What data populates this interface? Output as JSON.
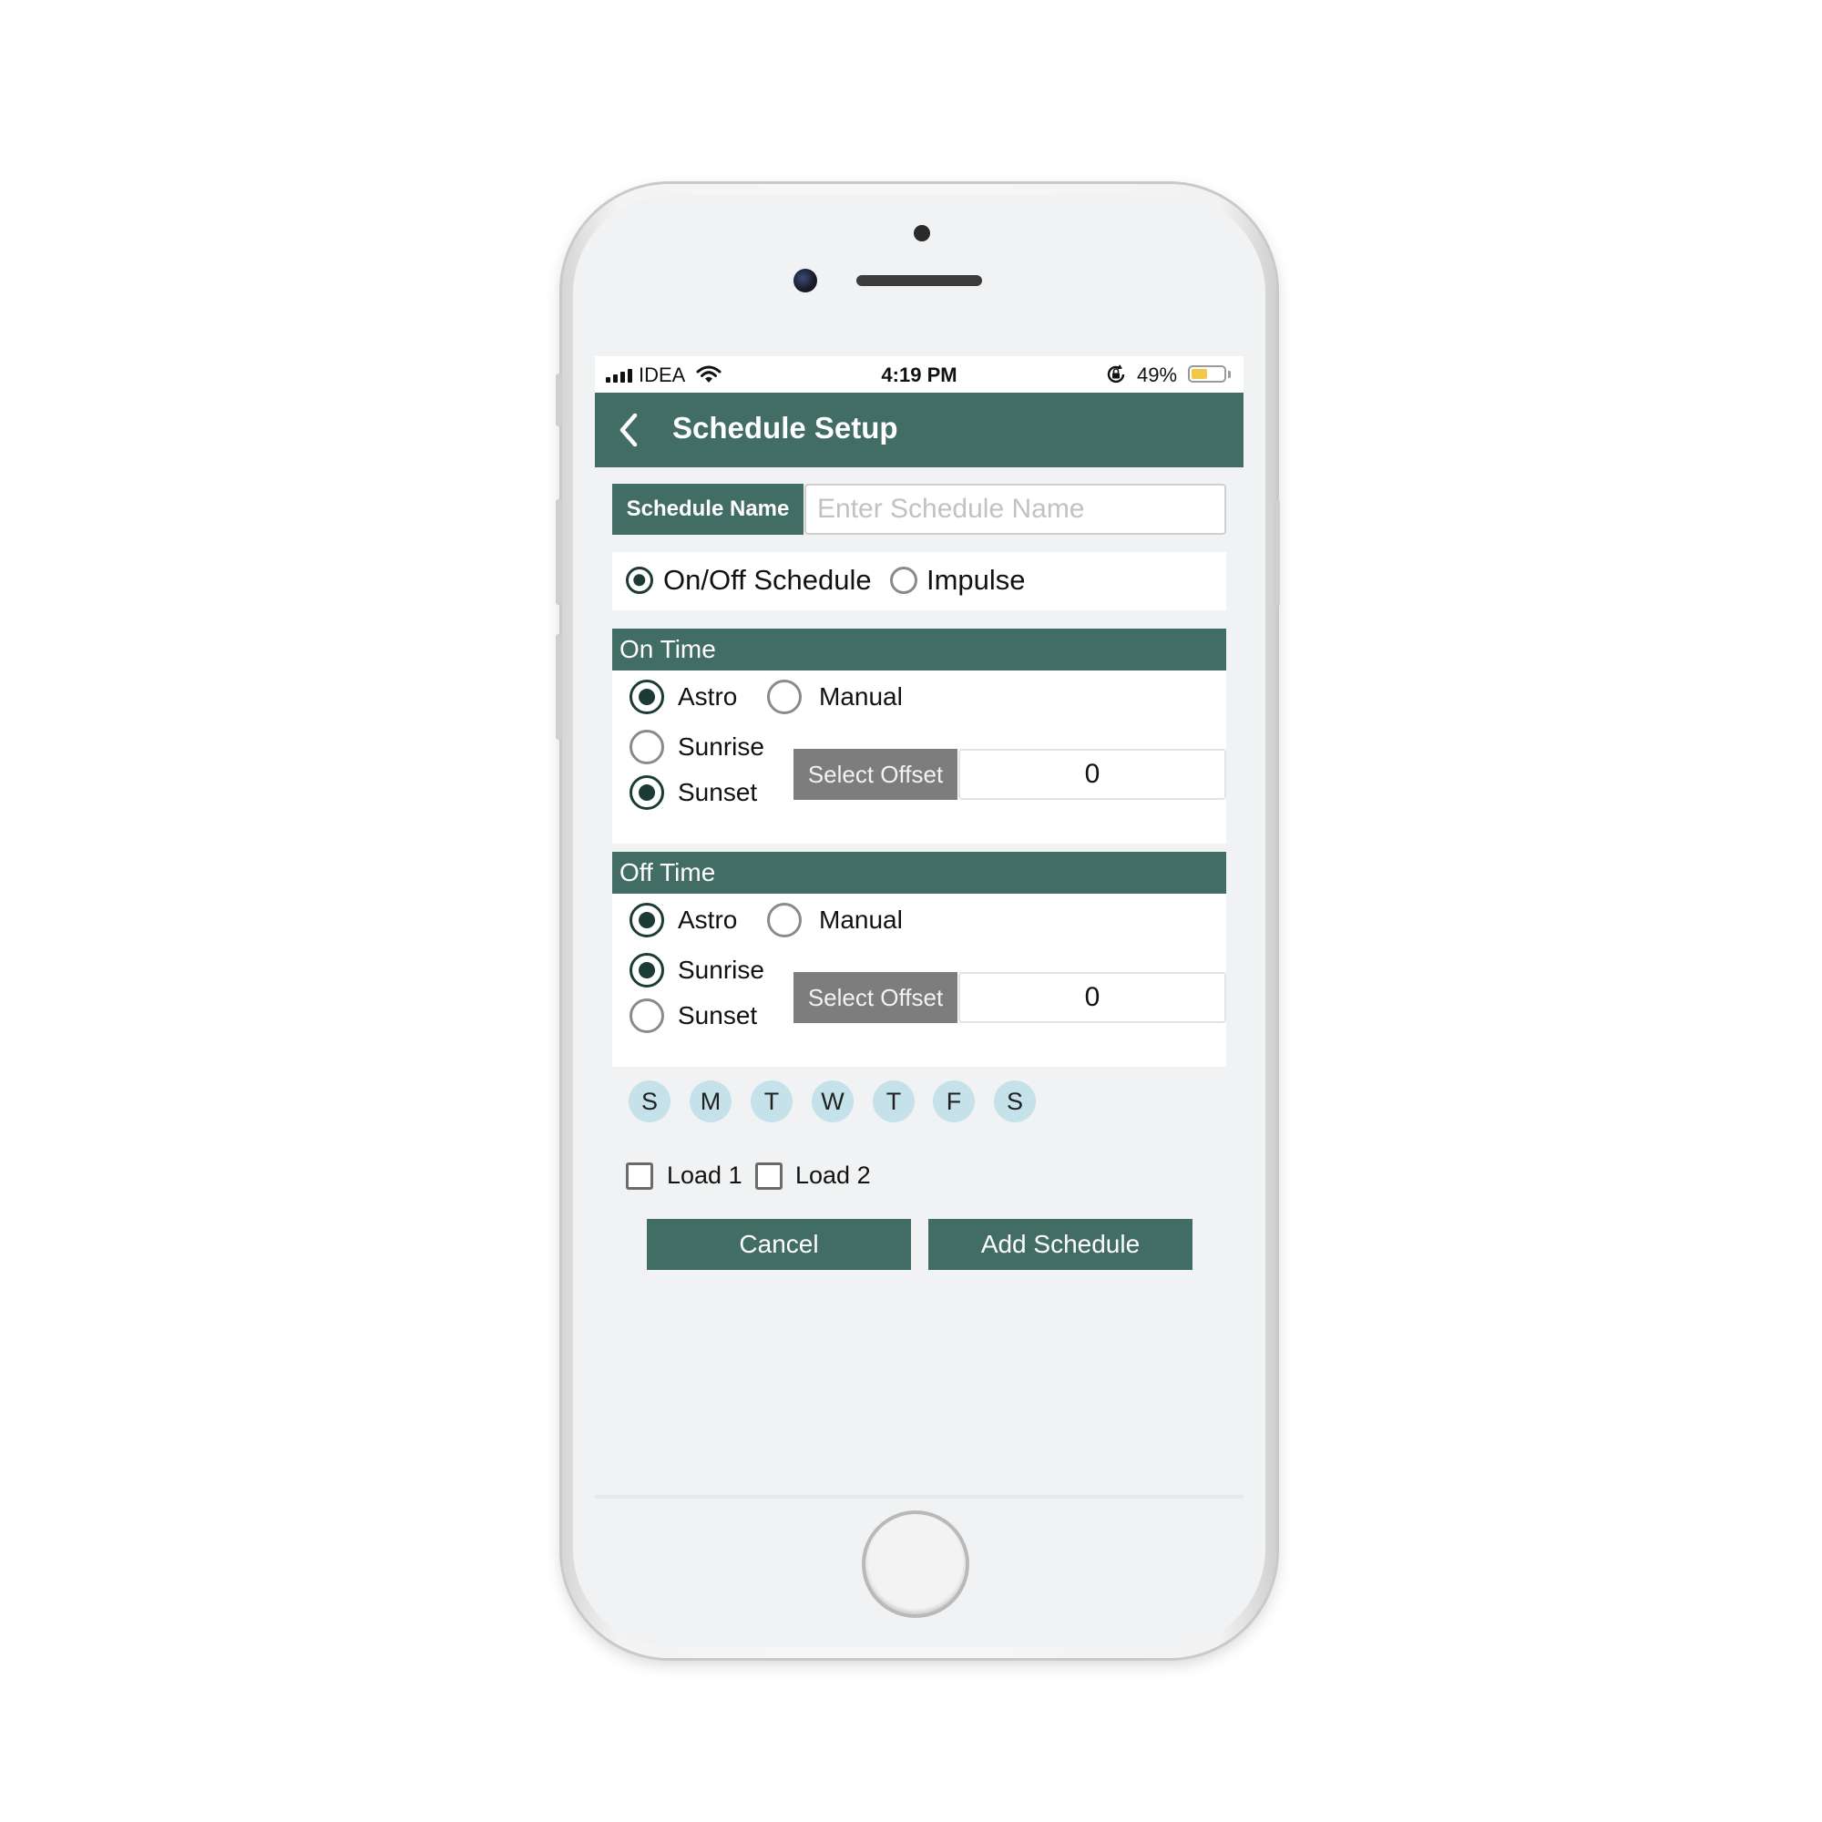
{
  "status_bar": {
    "carrier": "IDEA",
    "time": "4:19 PM",
    "battery_percent": "49%",
    "battery_level": 0.49,
    "icons": [
      "signal-icon",
      "wifi-icon",
      "orientation-lock-icon",
      "battery-icon"
    ]
  },
  "header": {
    "title": "Schedule Setup",
    "back_icon": "chevron-left-icon"
  },
  "schedule_name": {
    "label": "Schedule Name",
    "value": "",
    "placeholder": "Enter Schedule Name"
  },
  "schedule_type": {
    "options": [
      {
        "label": "On/Off Schedule",
        "selected": true
      },
      {
        "label": "Impulse",
        "selected": false
      }
    ]
  },
  "on_time": {
    "title": "On Time",
    "mode_options": [
      {
        "label": "Astro",
        "selected": true
      },
      {
        "label": "Manual",
        "selected": false
      }
    ],
    "event_options": [
      {
        "label": "Sunrise",
        "selected": false
      },
      {
        "label": "Sunset",
        "selected": true
      }
    ],
    "offset_label": "Select Offset",
    "offset_value": "0"
  },
  "off_time": {
    "title": "Off Time",
    "mode_options": [
      {
        "label": "Astro",
        "selected": true
      },
      {
        "label": "Manual",
        "selected": false
      }
    ],
    "event_options": [
      {
        "label": "Sunrise",
        "selected": true
      },
      {
        "label": "Sunset",
        "selected": false
      }
    ],
    "offset_label": "Select Offset",
    "offset_value": "0"
  },
  "days": [
    "S",
    "M",
    "T",
    "W",
    "T",
    "F",
    "S"
  ],
  "loads": [
    {
      "label": "Load 1",
      "checked": false
    },
    {
      "label": "Load 2",
      "checked": false
    }
  ],
  "actions": {
    "cancel_label": "Cancel",
    "add_label": "Add Schedule"
  },
  "colors": {
    "primary": "#426d64",
    "day_chip": "#c5e1ea",
    "offset_button": "#7d7d7d",
    "battery_fill": "#f2c84b"
  }
}
